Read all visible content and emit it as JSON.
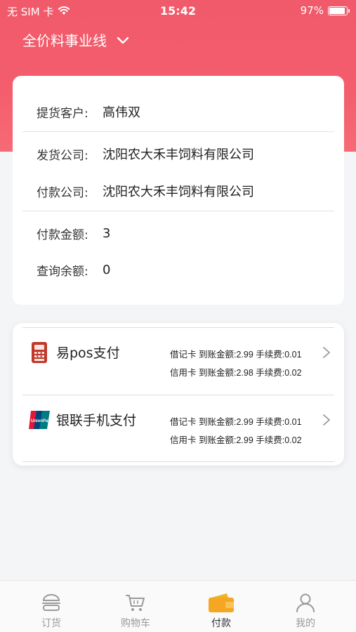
{
  "status_bar": {
    "carrier": "无 SIM 卡",
    "time": "15:42",
    "battery": "97%"
  },
  "header": {
    "business_line": "全价料事业线"
  },
  "info": {
    "customer_label": "提货客户:",
    "customer_value": "高伟双",
    "shipper_label": "发货公司:",
    "shipper_value": "沈阳农大禾丰饲料有限公司",
    "payer_label": "付款公司:",
    "payer_value": "沈阳农大禾丰饲料有限公司",
    "amount_label": "付款金额:",
    "amount_value": "3",
    "balance_label": "查询余额:",
    "balance_value": "0"
  },
  "payment_methods": [
    {
      "name": "易pos支付",
      "icon": "pos-terminal-icon",
      "debit": "借记卡  到账金额:2.99  手续费:0.01",
      "credit": "信用卡  到账金额:2.98  手续费:0.02"
    },
    {
      "name": "银联手机支付",
      "icon": "unionpay-icon",
      "debit": "借记卡  到账金额:2.99  手续费:0.01",
      "credit": "信用卡  到账金额:2.99  手续费:0.02"
    }
  ],
  "tabs": [
    {
      "label": "订货",
      "icon": "order-icon",
      "active": false
    },
    {
      "label": "购物车",
      "icon": "cart-icon",
      "active": false
    },
    {
      "label": "付款",
      "icon": "wallet-icon",
      "active": true
    },
    {
      "label": "我的",
      "icon": "user-icon",
      "active": false
    }
  ],
  "colors": {
    "header_red": "#f25d6b",
    "active_tab": "#f5a623"
  }
}
